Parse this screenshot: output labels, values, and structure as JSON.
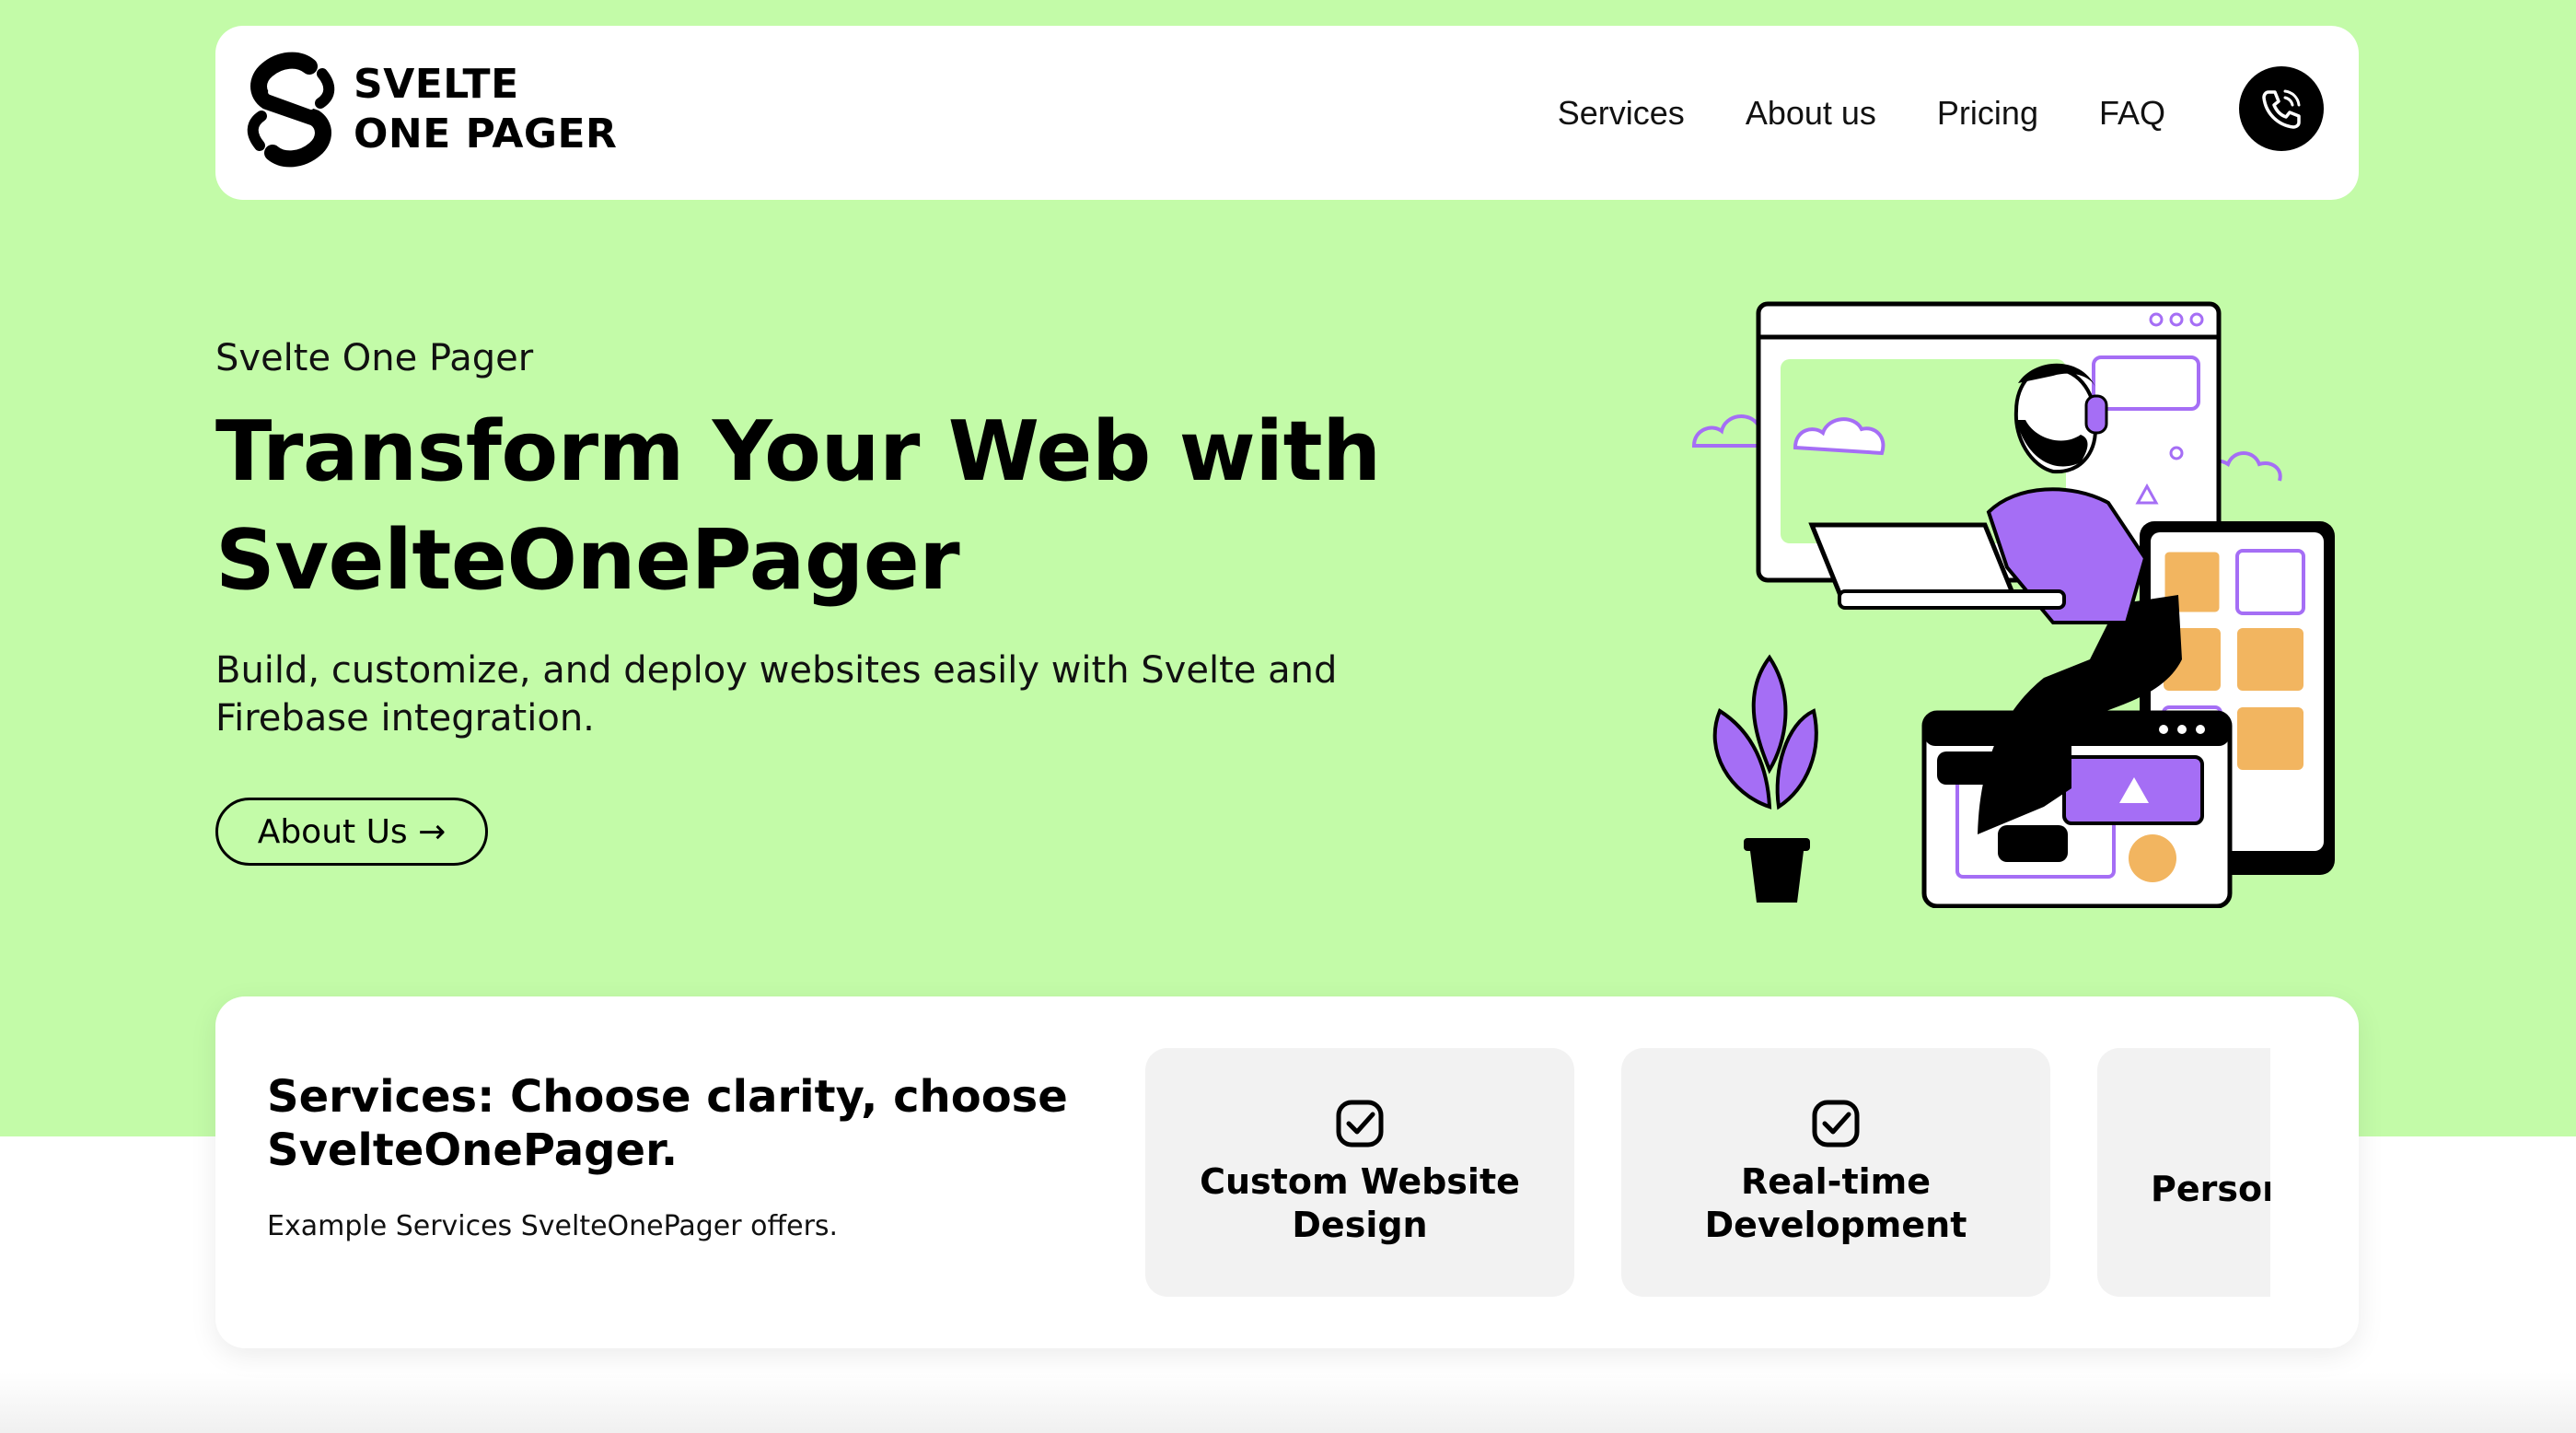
{
  "brand": {
    "line1": "SVELTE",
    "line2": "ONE PAGER",
    "icon": "svelte-logo-icon"
  },
  "nav": {
    "items": [
      {
        "label": "Services"
      },
      {
        "label": "About us"
      },
      {
        "label": "Pricing"
      },
      {
        "label": "FAQ"
      }
    ],
    "call_icon": "phone-icon"
  },
  "hero": {
    "eyebrow": "Svelte One Pager",
    "title_line1": "Transform Your Web with",
    "title_line2": "SvelteOnePager",
    "description": "Build, customize, and deploy websites easily with Svelte and Firebase integration.",
    "cta_label": "About Us →"
  },
  "services": {
    "title": "Services: Choose clarity, choose SvelteOnePager.",
    "subtitle": "Example Services SvelteOnePager offers.",
    "cards": [
      {
        "label": "Custom Website Design",
        "icon": "checkbox-icon"
      },
      {
        "label": "Real-time Development",
        "icon": "checkbox-icon"
      },
      {
        "label": "Person",
        "icon": "checkbox-icon"
      }
    ]
  },
  "colors": {
    "hero_bg": "#c3fba8",
    "accent_purple": "#a56ef5",
    "accent_orange": "#f2b560",
    "black": "#000000",
    "card_bg": "#f2f2f2"
  }
}
